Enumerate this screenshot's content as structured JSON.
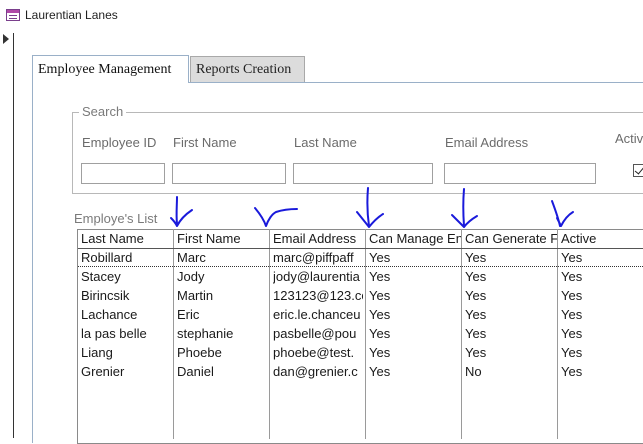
{
  "window": {
    "title": "Laurentian Lanes",
    "icon": "form-icon"
  },
  "tabs": [
    {
      "label": "Employee Management",
      "active": true
    },
    {
      "label": "Reports Creation",
      "active": false
    }
  ],
  "search": {
    "legend": "Search",
    "fields": [
      {
        "label": "Employee ID",
        "value": ""
      },
      {
        "label": "First Name",
        "value": ""
      },
      {
        "label": "Last Name",
        "value": ""
      },
      {
        "label": "Email Address",
        "value": ""
      }
    ],
    "active_label": "Activ",
    "active_checked": true
  },
  "list": {
    "label": "Employe's List",
    "columns": [
      "Last Name",
      "First Name",
      "Email Address",
      "Can Manage En",
      "Can Generate F",
      "Active"
    ],
    "rows": [
      [
        "Robillard",
        "Marc",
        "marc@piffpaff",
        "Yes",
        "Yes",
        "Yes"
      ],
      [
        "Stacey",
        "Jody",
        "jody@laurentia",
        "Yes",
        "Yes",
        "Yes"
      ],
      [
        "Birincsik",
        "Martin",
        "123123@123.co",
        "Yes",
        "Yes",
        "Yes"
      ],
      [
        "Lachance",
        "Eric",
        "eric.le.chanceu",
        "Yes",
        "Yes",
        "Yes"
      ],
      [
        "la pas belle",
        "stephanie",
        "pasbelle@pou",
        "Yes",
        "Yes",
        "Yes"
      ],
      [
        "Liang",
        "Phoebe",
        "phoebe@test.",
        "Yes",
        "Yes",
        "Yes"
      ],
      [
        "Grenier",
        "Daniel",
        "dan@grenier.c",
        "Yes",
        "No",
        "Yes"
      ]
    ]
  },
  "colors": {
    "annotation": "#1a1adb",
    "tab_border": "#9ab0c8"
  }
}
